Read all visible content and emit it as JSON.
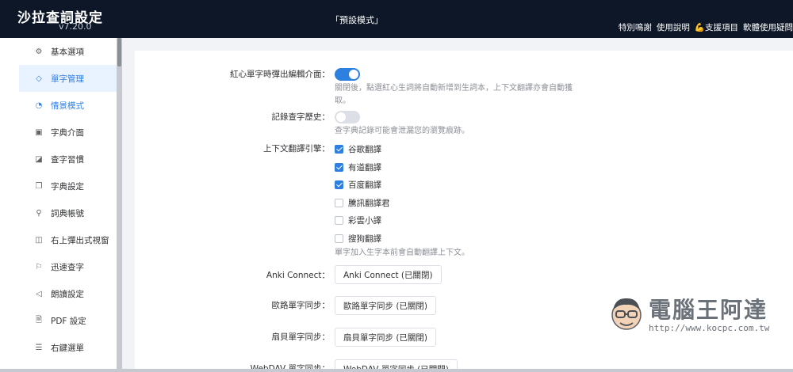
{
  "header": {
    "app_title": "沙拉查詞設定",
    "version": "v7.20.0",
    "mode_title": "「預設模式」",
    "links": {
      "thanks": "特別鳴謝",
      "manual": "使用說明",
      "support_icon": "💪",
      "support": "支援項目",
      "issues": "軟體使用疑問"
    }
  },
  "sidebar": {
    "items": [
      {
        "icon": "⚙",
        "label": "基本選項"
      },
      {
        "icon": "◇",
        "label": "單字管理"
      },
      {
        "icon": "◔",
        "label": "情景模式"
      },
      {
        "icon": "▣",
        "label": "字典介面"
      },
      {
        "icon": "◪",
        "label": "查字習慣"
      },
      {
        "icon": "❐",
        "label": "字典設定"
      },
      {
        "icon": "⚲",
        "label": "詞典帳號"
      },
      {
        "icon": "◫",
        "label": "右上彈出式視窗"
      },
      {
        "icon": "⚐",
        "label": "迅速查字"
      },
      {
        "icon": "◁",
        "label": "朗讀設定"
      },
      {
        "icon": "🗎",
        "label": "PDF 設定"
      },
      {
        "icon": "☰",
        "label": "右鍵選單"
      }
    ]
  },
  "settings": {
    "popup_label": "紅心單字時彈出編輯介面：",
    "popup_hint": "關閉後，點選紅心生詞將自動新增到生詞本，上下文翻譯亦會自動獲取。",
    "history_label": "記錄查字歷史：",
    "history_hint": "查字典記錄可能會泄漏您的瀏覽痕跡。",
    "engine_label": "上下文翻譯引擎：",
    "engines": [
      {
        "label": "谷歌翻譯",
        "checked": true
      },
      {
        "label": "有道翻譯",
        "checked": true
      },
      {
        "label": "百度翻譯",
        "checked": true
      },
      {
        "label": "騰訊翻譯君",
        "checked": false
      },
      {
        "label": "彩雲小譯",
        "checked": false
      },
      {
        "label": "搜狗翻譯",
        "checked": false
      }
    ],
    "engine_hint": "單字加入生字本前會自動翻譯上下文。",
    "anki_label": "Anki Connect：",
    "anki_button": "Anki Connect (已關閉)",
    "eudic_label": "歐路單字同步：",
    "eudic_button": "歐路單字同步 (已關閉)",
    "shanbay_label": "扇貝單字同步：",
    "shanbay_button": "扇貝單字同步 (已關閉)",
    "webdav_label": "WebDAV 單字同步：",
    "webdav_button": "WebDAV 單字同步 (已關閉)"
  },
  "watermark": {
    "title": "電腦王阿達",
    "url": "http://www.kocpc.com.tw"
  },
  "colors": {
    "header_bg": "#0d1727",
    "accent": "#2d7fe0"
  }
}
